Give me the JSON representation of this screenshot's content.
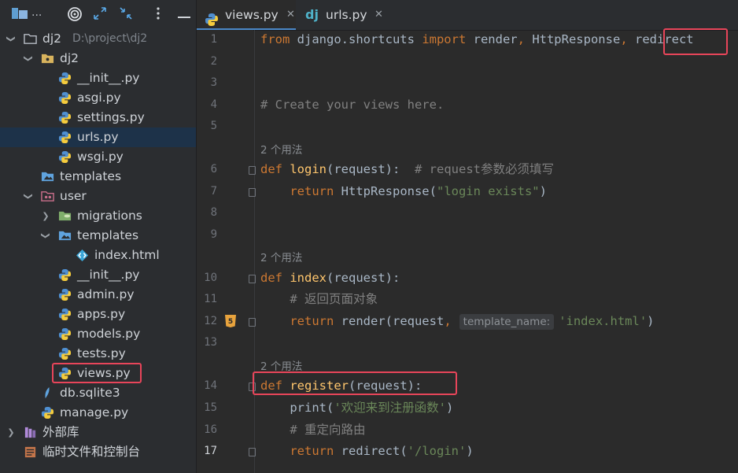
{
  "sidebar": {
    "toolbar": {
      "project_label": "..."
    },
    "tree": [
      {
        "label": "dj2",
        "path": "D:\\project\\dj2",
        "icon": "folder-icon",
        "chev": "down",
        "indent": 0
      },
      {
        "label": "dj2",
        "icon": "package-folder-icon",
        "chev": "down",
        "indent": 1
      },
      {
        "label": "__init__.py",
        "icon": "python-file-icon",
        "indent": 2
      },
      {
        "label": "asgi.py",
        "icon": "python-file-icon",
        "indent": 2
      },
      {
        "label": "settings.py",
        "icon": "python-file-icon",
        "indent": 2
      },
      {
        "label": "urls.py",
        "icon": "python-file-icon",
        "indent": 2,
        "selected": true
      },
      {
        "label": "wsgi.py",
        "icon": "python-file-icon",
        "indent": 2
      },
      {
        "label": "templates",
        "icon": "templates-folder-icon",
        "indent": 1
      },
      {
        "label": "user",
        "icon": "app-folder-icon",
        "chev": "down",
        "indent": 1
      },
      {
        "label": "migrations",
        "icon": "migrations-folder-icon",
        "chev": "right",
        "indent": 2
      },
      {
        "label": "templates",
        "icon": "templates-folder-icon",
        "chev": "down",
        "indent": 2
      },
      {
        "label": "index.html",
        "icon": "html-file-icon",
        "indent": 3
      },
      {
        "label": "__init__.py",
        "icon": "python-file-icon",
        "indent": 2
      },
      {
        "label": "admin.py",
        "icon": "python-file-icon",
        "indent": 2
      },
      {
        "label": "apps.py",
        "icon": "python-file-icon",
        "indent": 2
      },
      {
        "label": "models.py",
        "icon": "python-file-icon",
        "indent": 2
      },
      {
        "label": "tests.py",
        "icon": "python-file-icon",
        "indent": 2
      },
      {
        "label": "views.py",
        "icon": "python-file-icon",
        "indent": 2
      },
      {
        "label": "db.sqlite3",
        "icon": "database-file-icon",
        "indent": 1
      },
      {
        "label": "manage.py",
        "icon": "python-file-icon",
        "indent": 1
      },
      {
        "label": "外部库",
        "icon": "library-icon",
        "chev": "right",
        "indent": 0
      },
      {
        "label": "临时文件和控制台",
        "icon": "scratch-icon",
        "indent": 0
      }
    ]
  },
  "tabs": [
    {
      "label": "views.py",
      "icon": "python-file-icon",
      "active": true
    },
    {
      "label": "urls.py",
      "icon": "django-icon",
      "active": false
    }
  ],
  "editor": {
    "usage_label": "2 个用法",
    "line_numbers": [
      "1",
      "2",
      "3",
      "4",
      "5",
      "6",
      "7",
      "8",
      "9",
      "10",
      "11",
      "12",
      "13",
      "14",
      "15",
      "16",
      "17"
    ],
    "hint_label": "template_name:"
  },
  "colors": {
    "highlight_box": "#e8455a",
    "selection": "#1d3249"
  }
}
